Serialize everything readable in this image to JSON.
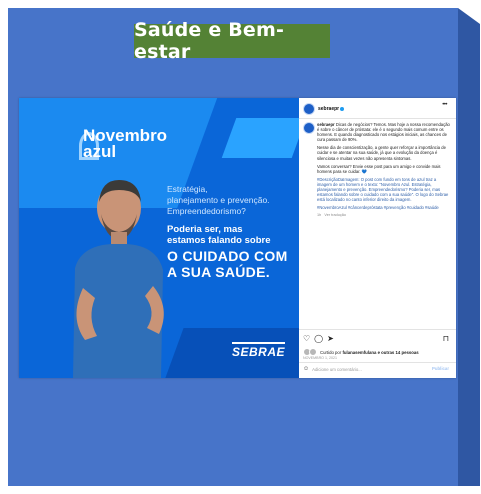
{
  "slide": {
    "title": "Saúde e Bem-estar",
    "colors": {
      "panel": "#4774c9",
      "title_bg": "#548235"
    }
  },
  "post": {
    "image": {
      "title": "Novembro azul",
      "tagline_lines": [
        "Estratégia,",
        "planejamento e prevenção.",
        "Empreendedorismo?"
      ],
      "subtitle_lines": [
        "Poderia ser, mas",
        "estamos falando sobre"
      ],
      "headline_lines": [
        "O CUIDADO COM",
        "A SUA SAÚDE."
      ],
      "brand": "SEBRAE"
    },
    "header": {
      "username": "sebraepr",
      "verified_icon": "verified-badge-icon",
      "more_icon": "more-options-icon"
    },
    "caption": {
      "username": "sebraepr",
      "paragraphs": [
        "Dicas de negócios? Temos. Mas hoje a nossa recomendação é sobre o câncer de próstata: ele é o segundo mais comum entre os homens. E quando diagnosticado nos estágios iniciais, as chances de cura passam de 90%.",
        "Nesse dia de conscientização, a gente quer reforçar a importância de cuidar e se atentar na sua saúde, já que a evolução da doença é silenciosa e muitas vezes não apresenta sintomas.",
        "Vamos conversar? Envie esse post para um amigo e convide mais homens para se cuidar. 💙",
        "#DescriçãoDaImagem: O post com fundo em tons de azul traz a imagem de um homem e o texto: \"Novembro Azul. Estratégia, planejamento e prevenção. Empreendedorismo? Poderia ser, mas estamos falando sobre o cuidado com a sua saúde\". O logo do Sebrae está localizado no canto inferior direito da imagem."
      ],
      "hashtags": "#NovembroAzul #câncerdepróstata #prevenção #cuidado #saúde",
      "meta_time": "1h",
      "meta_translate": "Ver tradução"
    },
    "actions": {
      "like_icon": "heart-icon",
      "comment_icon": "comment-icon",
      "share_icon": "share-icon",
      "save_icon": "bookmark-icon"
    },
    "likes": {
      "text": "Curtido por",
      "user": "fulanasemfulana",
      "rest": "e outras 14 pessoas"
    },
    "date": "NOVEMBRO 1, 2021",
    "comment_box": {
      "emoji_icon": "smiley-icon",
      "placeholder": "Adicione um comentário...",
      "publish_label": "Publicar"
    }
  }
}
